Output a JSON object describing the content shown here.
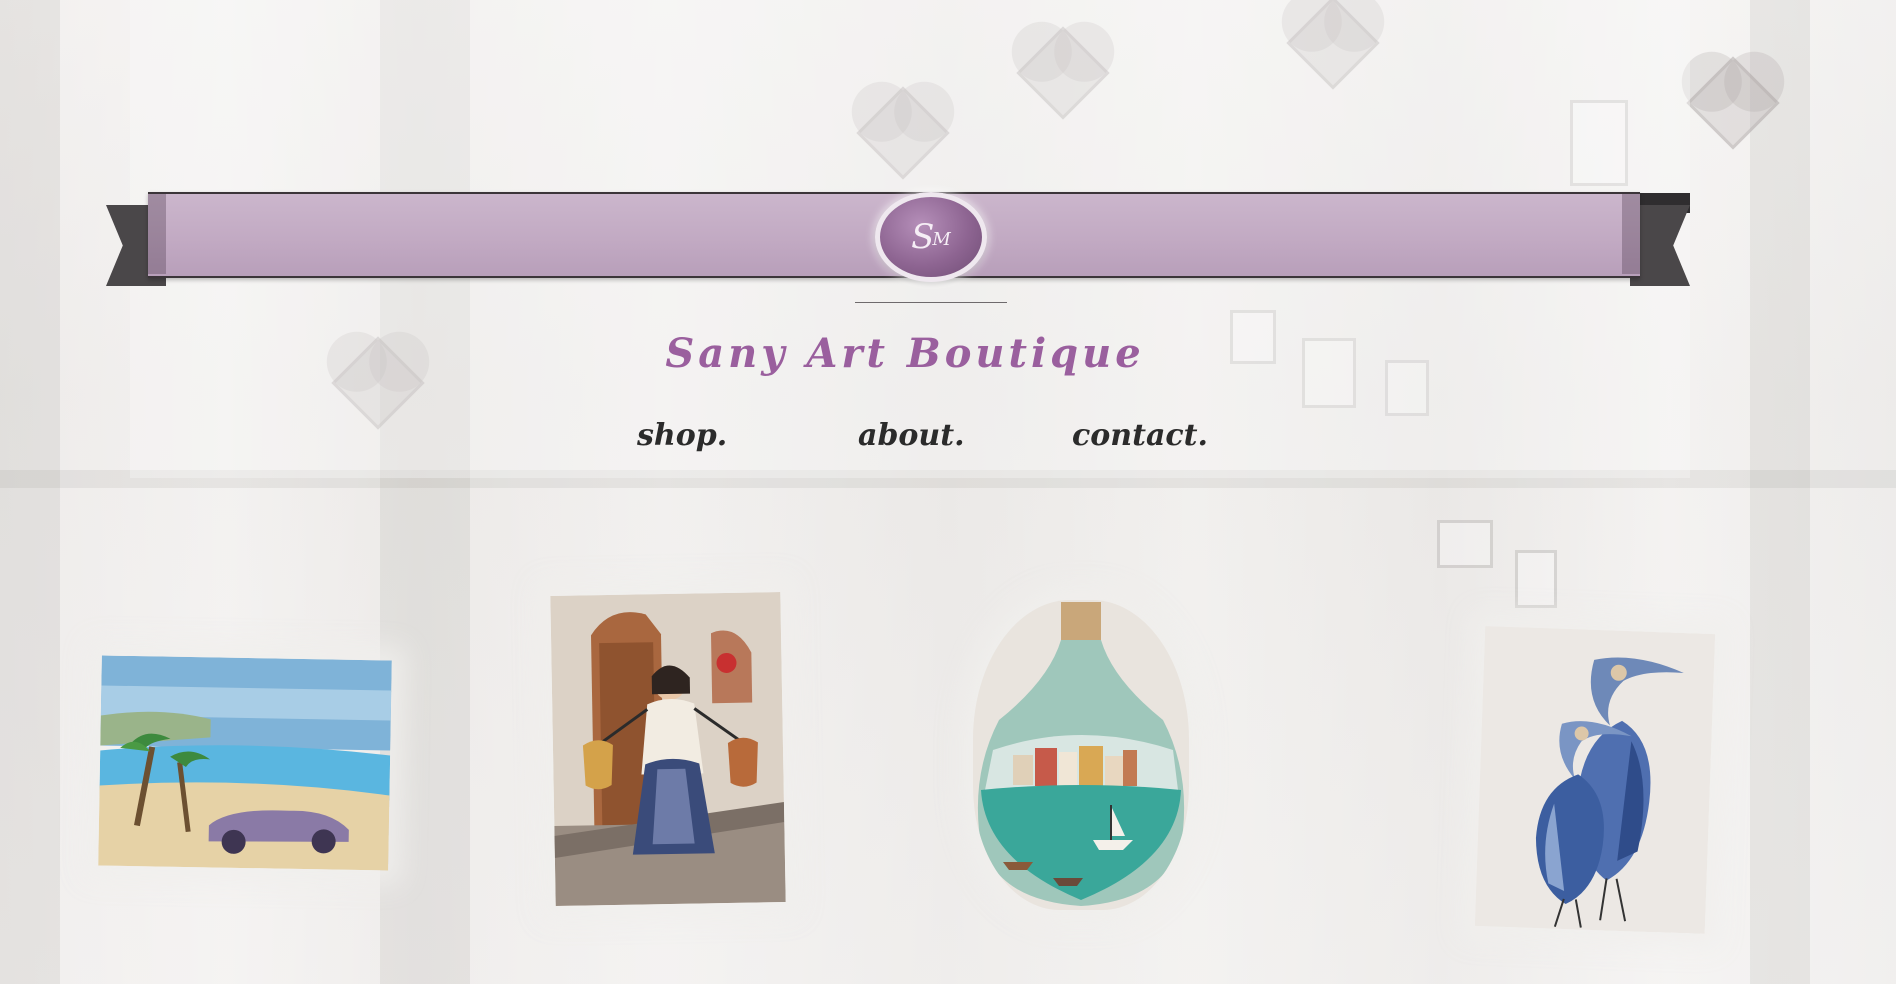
{
  "site": {
    "title": "Sany Art Boutique",
    "logo_monogram": "SM",
    "logo_letter_1": "S",
    "logo_letter_2": "M"
  },
  "nav": {
    "items": [
      {
        "label": "shop."
      },
      {
        "label": "about."
      },
      {
        "label": "contact."
      }
    ]
  },
  "gallery": {
    "items": [
      {
        "subject": "painted-beach-with-car",
        "icon": "painting-icon"
      },
      {
        "subject": "painted-woman-carrying-jugs",
        "icon": "painting-icon"
      },
      {
        "subject": "painted-bottle-harbor-scene",
        "icon": "bottle-icon"
      },
      {
        "subject": "painted-blue-herons",
        "icon": "painting-icon"
      }
    ]
  },
  "colors": {
    "ribbon": "#c2aac3",
    "title": "#9a5f9e",
    "nav_text": "#2b2b2b",
    "ribbon_tail": "#4a4749",
    "logo": "#8e6592"
  }
}
